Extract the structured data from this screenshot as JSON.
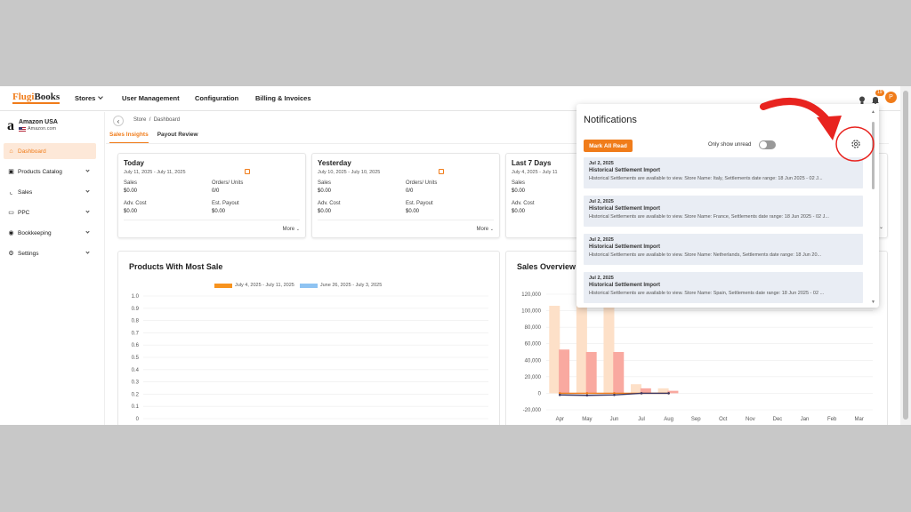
{
  "brand": {
    "logo_text": "FlugiBooks"
  },
  "topnav": {
    "stores": "Stores",
    "user_management": "User Management",
    "configuration": "Configuration",
    "billing": "Billing & Invoices",
    "badge_count": "19",
    "avatar_letter": "P"
  },
  "store": {
    "name": "Amazon USA",
    "sub": "Amazon.com"
  },
  "sidebar": {
    "items": [
      {
        "label": "Dashboard",
        "icon": "home-icon"
      },
      {
        "label": "Products Catalog",
        "icon": "box-icon"
      },
      {
        "label": "Sales",
        "icon": "sales-chart-icon"
      },
      {
        "label": "PPC",
        "icon": "ppc-icon"
      },
      {
        "label": "Bookkeeping",
        "icon": "book-icon"
      },
      {
        "label": "Settings",
        "icon": "gear-icon"
      }
    ]
  },
  "breadcrumb": {
    "store": "Store",
    "sep": "/",
    "page": "Dashboard"
  },
  "tabs": {
    "sales_insights": "Sales Insights",
    "payout_review": "Payout Review"
  },
  "cards": [
    {
      "title": "Today",
      "dates": "July 11, 2025 - July 11, 2025",
      "sales_label": "Sales",
      "sales": "$0.00",
      "orders_label": "Orders/ Units",
      "orders": "0/0",
      "adv_label": "Adv. Cost",
      "adv": "$0.00",
      "payout_label": "Est. Payout",
      "payout": "$0.00",
      "more": "More"
    },
    {
      "title": "Yesterday",
      "dates": "July 10, 2025 - July 10, 2025",
      "sales_label": "Sales",
      "sales": "$0.00",
      "orders_label": "Orders/ Units",
      "orders": "0/0",
      "adv_label": "Adv. Cost",
      "adv": "$0.00",
      "payout_label": "Est. Payout",
      "payout": "$0.00",
      "more": "More"
    },
    {
      "title": "Last 7 Days",
      "dates": "July 4, 2025 - July 11",
      "sales_label": "Sales",
      "sales": "$0.00",
      "adv_label": "Adv. Cost",
      "adv": "$0.00"
    }
  ],
  "products_panel": {
    "title": "Products With Most Sale",
    "legend": [
      {
        "label": "July 4, 2025 - July 11, 2025",
        "color": "#f7931e"
      },
      {
        "label": "June 26, 2025 - July 3, 2025",
        "color": "#8ec3f2"
      }
    ]
  },
  "sales_panel": {
    "title": "Sales Overview"
  },
  "chart_data": [
    {
      "type": "bar",
      "title": "Products With Most Sale",
      "series": [
        {
          "name": "July 4, 2025 - July 11, 2025",
          "values": []
        },
        {
          "name": "June 26, 2025 - July 3, 2025",
          "values": []
        }
      ],
      "y_ticks": [
        "1.0",
        "0.9",
        "0.8",
        "0.7",
        "0.6",
        "0.5",
        "0.4",
        "0.3",
        "0.2",
        "0.1",
        "0"
      ],
      "ylim": [
        0,
        1.0
      ]
    },
    {
      "type": "bar",
      "title": "Sales Overview",
      "categories": [
        "Apr",
        "May",
        "Jun",
        "Jul",
        "Aug",
        "Sep",
        "Oct",
        "Nov",
        "Dec",
        "Jan",
        "Feb",
        "Mar"
      ],
      "y_ticks": [
        "120,000",
        "100,000",
        "80,000",
        "60,000",
        "40,000",
        "20,000",
        "0",
        "-20,000"
      ],
      "ylim": [
        -20000,
        120000
      ],
      "series": [
        {
          "type": "bar",
          "color": "#fde0c8",
          "values": [
            106000,
            113000,
            105000,
            11000,
            6000,
            0,
            0,
            0,
            0,
            0,
            0,
            0
          ]
        },
        {
          "type": "bar",
          "color": "#f9a9a0",
          "values": [
            53000,
            50000,
            50000,
            6000,
            3000,
            0,
            0,
            0,
            0,
            0,
            0,
            0
          ]
        },
        {
          "type": "line",
          "color": "#f07c1a",
          "values": [
            0,
            0,
            0,
            0,
            0
          ]
        },
        {
          "type": "line",
          "color": "#3a3560",
          "values": [
            -2000,
            -2500,
            -2000,
            0,
            0
          ]
        }
      ]
    }
  ],
  "notifications": {
    "title": "Notifications",
    "mark_all_read": "Mark All Read",
    "only_unread": "Only show unread",
    "items": [
      {
        "date": "Jul 2, 2025",
        "heading": "Historical Settlement Import",
        "body": "Historical Settlements are available to view. Store Name: Italy, Settlements date range: 18 Jun 2025 - 02 J..."
      },
      {
        "date": "Jul 2, 2025",
        "heading": "Historical Settlement Import",
        "body": "Historical Settlements are available to view. Store Name: France, Settlements date range: 18 Jun 2025 - 02 J..."
      },
      {
        "date": "Jul 2, 2025",
        "heading": "Historical Settlement Import",
        "body": "Historical Settlements are available to view. Store Name: Netherlands, Settlements date range: 18 Jun 20..."
      },
      {
        "date": "Jul 2, 2025",
        "heading": "Historical Settlement Import",
        "body": "Historical Settlements are available to view. Store Name: Spain, Settlements date range: 18 Jun 2025 - 02 ..."
      }
    ]
  },
  "colors": {
    "accent": "#f07c1a",
    "annotation_red": "#e8231f"
  }
}
